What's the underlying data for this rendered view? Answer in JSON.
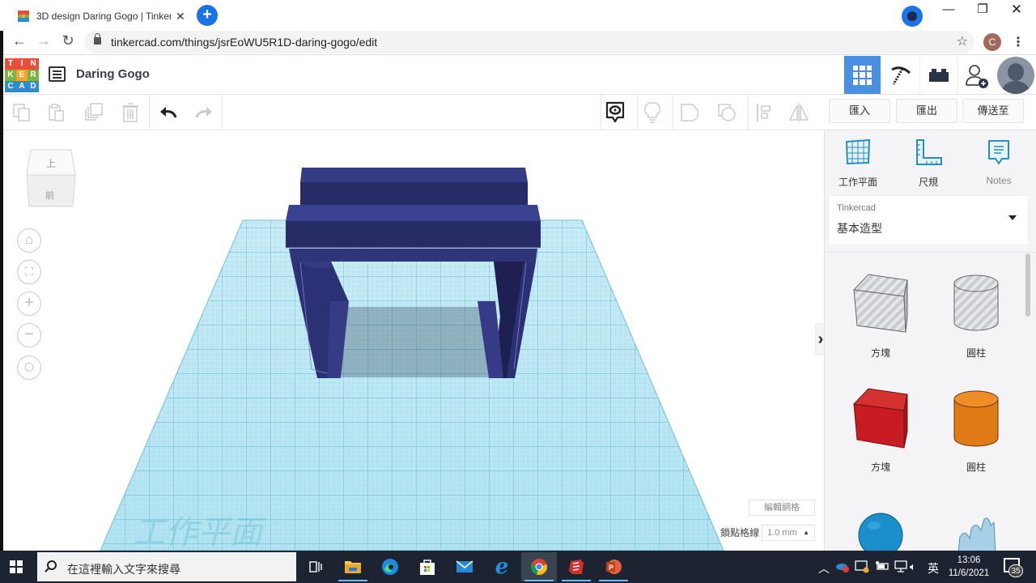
{
  "browser": {
    "tab_title": "3D design Daring Gogo | Tinker",
    "url": "tinkercad.com/things/jsrEoWU5R1D-daring-gogo/edit",
    "profile_initial": "C",
    "window_controls": [
      "minimize",
      "restore",
      "close"
    ]
  },
  "header": {
    "logo_letters": [
      "T",
      "I",
      "N",
      "K",
      "E",
      "R",
      "C",
      "A",
      "D"
    ],
    "logo_colors": [
      "#e94e3c",
      "#e94e3c",
      "#e94e3c",
      "#7cb342",
      "#7cb342",
      "#7cb342",
      "#2e8bd0",
      "#2e8bd0",
      "#2e8bd0"
    ],
    "design_name": "Daring Gogo",
    "mode_buttons": [
      {
        "name": "3d-design",
        "icon": "grid-icon",
        "active": true
      },
      {
        "name": "codeblocks",
        "icon": "pickaxe-icon",
        "active": false
      },
      {
        "name": "bricks",
        "icon": "brick-icon",
        "active": false
      },
      {
        "name": "invite",
        "icon": "add-user-icon",
        "active": false
      }
    ],
    "accent_color": "#4a90e2"
  },
  "toolbar": {
    "left_tools": [
      "copy",
      "paste",
      "duplicate",
      "delete"
    ],
    "history": [
      "undo",
      "redo"
    ],
    "view_tools": [
      "notes-visibility",
      "light",
      "workplane-shape",
      "group-shape",
      "align",
      "mirror"
    ],
    "import_label": "匯入",
    "export_label": "匯出",
    "send_to_label": "傳送至"
  },
  "workspace": {
    "viewcube_top": "上",
    "viewcube_front": "前",
    "nav_buttons": [
      "home",
      "fit-all",
      "zoom-in",
      "zoom-out",
      "perspective"
    ],
    "workplane_watermark": "工作平面",
    "edit_grid_label": "編輯網格",
    "snap_grid_label": "鎖點格線",
    "snap_grid_value": "1.0 mm",
    "model_color": "#2e3273"
  },
  "right_panel": {
    "tools": [
      {
        "label": "工作平面",
        "icon": "workplane-icon"
      },
      {
        "label": "尺規",
        "icon": "ruler-icon"
      },
      {
        "label": "Notes",
        "icon": "notes-icon"
      }
    ],
    "library_category": "Tinkercad",
    "library_value": "基本造型",
    "shapes": [
      {
        "label": "方塊",
        "kind": "box-hole"
      },
      {
        "label": "圓柱",
        "kind": "cylinder-hole"
      },
      {
        "label": "方塊",
        "kind": "box"
      },
      {
        "label": "圓柱",
        "kind": "cylinder"
      },
      {
        "label": "",
        "kind": "sphere"
      },
      {
        "label": "",
        "kind": "scribble"
      }
    ]
  },
  "taskbar": {
    "search_placeholder": "在這裡輸入文字來搜尋",
    "apps": [
      "task-view",
      "file-explorer",
      "edge",
      "store",
      "mail",
      "internet-explorer",
      "chrome",
      "sketchup",
      "powerpoint"
    ],
    "ime": "英",
    "time": "13:06",
    "date": "11/6/2021",
    "notification_count": "35"
  }
}
